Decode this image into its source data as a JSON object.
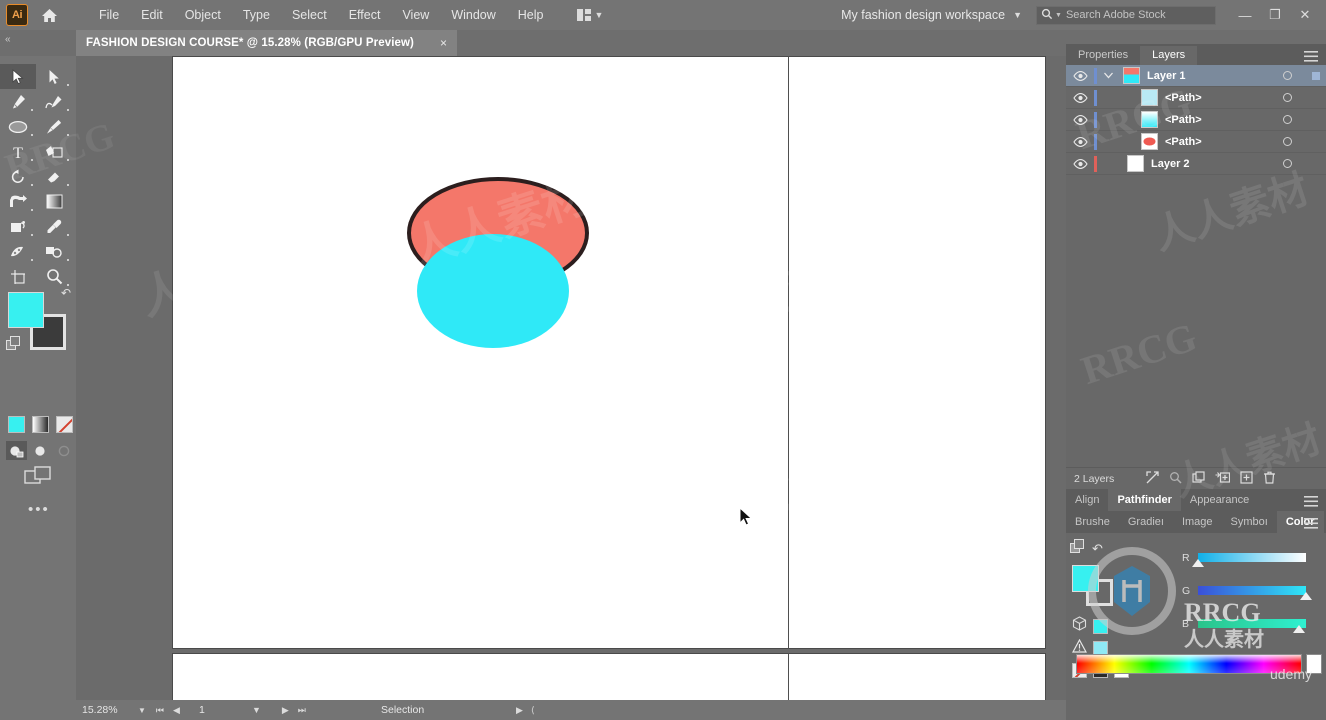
{
  "app": {
    "name": "Adobe Illustrator",
    "logo_text": "Ai"
  },
  "menubar": {
    "items": [
      "File",
      "Edit",
      "Object",
      "Type",
      "Select",
      "Effect",
      "View",
      "Window",
      "Help"
    ],
    "arrange_icon": "arrange-documents-icon",
    "workspace": "My fashion design workspace",
    "search_placeholder": "Search Adobe Stock",
    "search_value": "",
    "window_buttons": [
      "minimize",
      "restore",
      "close"
    ]
  },
  "document": {
    "tab_title": "FASHION DESIGN COURSE* @ 15.28% (RGB/GPU Preview)",
    "close_label": "×"
  },
  "toolbar": {
    "tools": [
      {
        "name": "selection-tool",
        "selected": true
      },
      {
        "name": "direct-selection-tool",
        "selected": false
      },
      {
        "name": "pen-tool",
        "selected": false
      },
      {
        "name": "curvature-tool",
        "selected": false
      },
      {
        "name": "ellipse-tool",
        "selected": false
      },
      {
        "name": "paintbrush-tool",
        "selected": false
      },
      {
        "name": "type-tool",
        "selected": false
      },
      {
        "name": "touch-type-tool",
        "selected": false
      },
      {
        "name": "rotate-tool",
        "selected": false
      },
      {
        "name": "eraser-tool",
        "selected": false
      },
      {
        "name": "free-transform-tool",
        "selected": false
      },
      {
        "name": "gradient-tool",
        "selected": false
      },
      {
        "name": "shape-builder-tool",
        "selected": false
      },
      {
        "name": "eyedropper-tool",
        "selected": false
      },
      {
        "name": "symbol-sprayer-tool",
        "selected": false
      },
      {
        "name": "column-graph-tool",
        "selected": false
      },
      {
        "name": "artboard-tool",
        "selected": false
      },
      {
        "name": "zoom-tool",
        "selected": false
      }
    ],
    "fill_color": "#37F0F0",
    "stroke_color": "#3B3B3B",
    "color_modes": [
      "color-mode-icon",
      "gradient-mode-icon",
      "none-mode-icon"
    ],
    "draw_modes": [
      "draw-normal-icon",
      "draw-behind-icon",
      "draw-inside-icon"
    ],
    "screen_mode": "screen-mode-icon",
    "more_tools": "•••"
  },
  "canvas": {
    "artboards": [
      "artboard-1",
      "artboard-2",
      "artboard-3",
      "artboard-4"
    ],
    "shapes": [
      {
        "name": "red-ellipse",
        "fill": "#F4776A",
        "stroke": "#2C1E1E"
      },
      {
        "name": "cyan-ellipse",
        "fill": "#2FE9F7",
        "stroke": "none"
      }
    ],
    "cursor": "arrow-pointer"
  },
  "statusbar": {
    "zoom": "15.28%",
    "page": "1",
    "tool_status": "Selection"
  },
  "panels": {
    "top_tabs": [
      {
        "label": "Properties",
        "active": false
      },
      {
        "label": "Layers",
        "active": true
      }
    ],
    "layers": [
      {
        "name": "Layer 1",
        "selected": true,
        "type": "layer",
        "color": "#6f8fd0",
        "thumb": "layer-composite",
        "expanded": true
      },
      {
        "name": "<Path>",
        "selected": false,
        "type": "path",
        "color": "#6f8fd0",
        "thumb": "cyan-red-path"
      },
      {
        "name": "<Path>",
        "selected": false,
        "type": "path",
        "color": "#6f8fd0",
        "thumb": "cyan-path"
      },
      {
        "name": "<Path>",
        "selected": false,
        "type": "path",
        "color": "#6f8fd0",
        "thumb": "red-path"
      },
      {
        "name": "Layer 2",
        "selected": false,
        "type": "layer",
        "color": "#e0615a",
        "thumb": "blank-white"
      }
    ],
    "layers_footer": {
      "count": "2 Layers",
      "icons": [
        "locate-object-icon",
        "search-icon",
        "duplicate-icon",
        "new-sublayer-icon",
        "new-layer-icon",
        "delete-layer-icon"
      ]
    },
    "mid_tabs": [
      {
        "label": "Align",
        "active": false
      },
      {
        "label": "Pathfinder",
        "active": true
      },
      {
        "label": "Appearance",
        "active": false
      }
    ],
    "bottom_tabs": [
      {
        "label": "Brushe",
        "active": false
      },
      {
        "label": "Gradieı",
        "active": false
      },
      {
        "label": "Image",
        "active": false
      },
      {
        "label": "Symboı",
        "active": false
      },
      {
        "label": "Color",
        "active": true
      }
    ],
    "color": {
      "mode": "RGB",
      "fill": "#37F0F0",
      "stroke": "#686868",
      "sliders": [
        {
          "label": "R",
          "value": "0",
          "percent": 0,
          "track_from": "#10b0e8",
          "track_to": "#ffffff"
        },
        {
          "label": "G",
          "value": "255",
          "percent": 100,
          "track_from": "#3a4fd8",
          "track_to": "#2fe6f6"
        },
        {
          "label": "B",
          "value": "239",
          "percent": 94,
          "track_from": "#2ac48a",
          "track_to": "#2ff0d0"
        }
      ],
      "swatch_icons": [
        "3d-cube-icon",
        "out-of-gamut-icon"
      ],
      "none_swatch": "none-swatch",
      "black_swatch": "#2A2A2A",
      "white_swatch": "#FFFFFF"
    }
  },
  "watermarks": {
    "rrcg": "RRCG",
    "chinese": "人人素材",
    "udemy": "udemy"
  }
}
